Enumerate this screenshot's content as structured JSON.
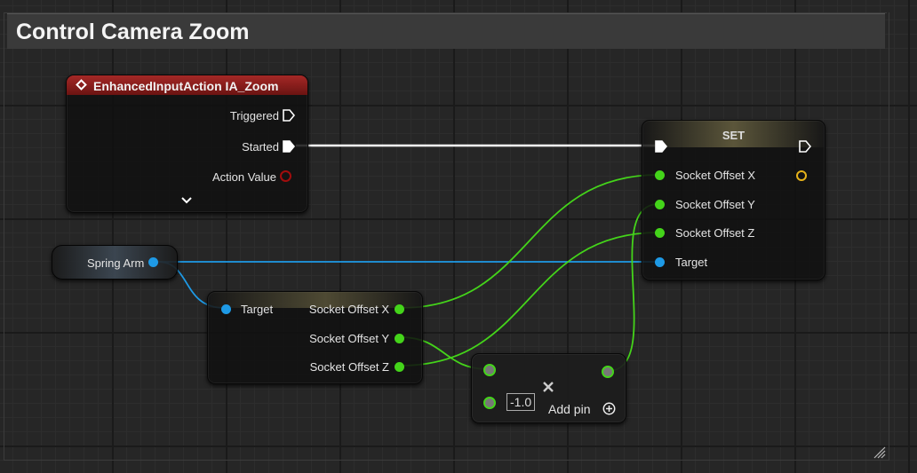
{
  "comment": {
    "title": "Control Camera Zoom"
  },
  "event_node": {
    "title": "EnhancedInputAction IA_Zoom",
    "pins": {
      "triggered": "Triggered",
      "started": "Started",
      "action_value": "Action Value"
    },
    "expand_icon": "chevron-down-icon",
    "header_color": "#a52826"
  },
  "spring_arm_node": {
    "label": "Spring Arm"
  },
  "get_node": {
    "target": "Target",
    "outputs": [
      "Socket Offset X",
      "Socket Offset Y",
      "Socket Offset Z"
    ]
  },
  "set_node": {
    "title": "SET",
    "pins": [
      "Socket Offset X",
      "Socket Offset Y",
      "Socket Offset Z",
      "Target"
    ]
  },
  "multiply_node": {
    "value": "-1.0",
    "add_pin_label": "Add pin",
    "remove_icon": "close-icon",
    "add_icon": "plus-circle-icon"
  },
  "colors": {
    "float_pin": "#44d41a",
    "object_pin": "#1e9ae6",
    "exec_wire": "#ffffff"
  }
}
